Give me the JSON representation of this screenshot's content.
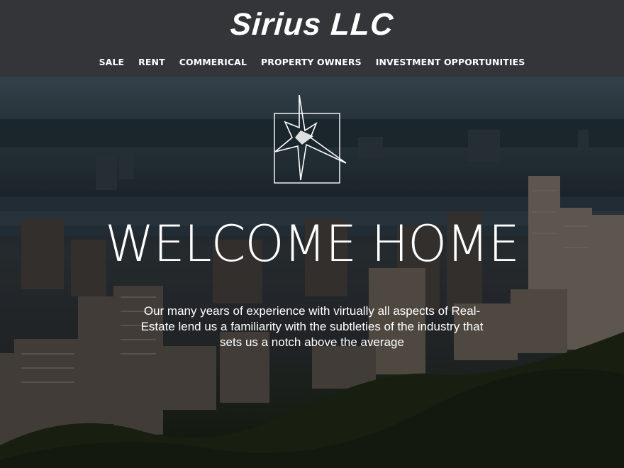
{
  "header": {
    "brand": "Sirius LLC",
    "nav": [
      "SALE",
      "RENT",
      "COMMERICAL",
      "PROPERTY OWNERS",
      "INVESTMENT OPPORTUNITIES"
    ]
  },
  "hero": {
    "logo_icon": "compass-star-icon",
    "headline": "WELCOME HOME",
    "tagline": "Our many years of experience with virtually all aspects of Real-Estate lend us a familiarity with the subtleties of the industry that sets us a notch above the average",
    "background": "city-skyline-photo"
  },
  "colors": {
    "header_bg": "#333538",
    "text": "#ffffff"
  }
}
